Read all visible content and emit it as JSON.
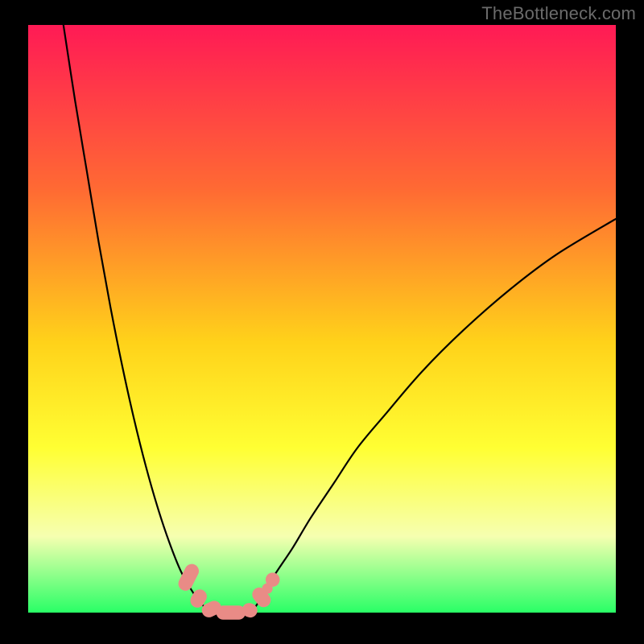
{
  "watermark": "TheBottleneck.com",
  "colors": {
    "bg": "#000000",
    "grad_top": "#ff1a55",
    "grad_mid1": "#ff6a33",
    "grad_mid2": "#ffd21a",
    "grad_mid3": "#ffff33",
    "grad_low": "#f6ffb0",
    "grad_bottom": "#29ff66",
    "curve": "#000000",
    "marker_fill": "#e98b86",
    "marker_stroke": "#d66e69"
  },
  "chart_data": {
    "type": "line",
    "title": "",
    "xlabel": "",
    "ylabel": "",
    "xlim": [
      0,
      100
    ],
    "ylim": [
      0,
      100
    ],
    "series": [
      {
        "name": "left-curve",
        "x": [
          6,
          8,
          10,
          12,
          14,
          16,
          18,
          20,
          22,
          24,
          26,
          28,
          29.5,
          31
        ],
        "y": [
          100,
          87,
          75,
          63,
          52,
          42,
          33,
          25,
          18,
          12,
          7,
          3.5,
          1.5,
          0
        ]
      },
      {
        "name": "right-curve",
        "x": [
          38,
          40,
          42,
          45,
          48,
          52,
          56,
          61,
          67,
          74,
          82,
          90,
          100
        ],
        "y": [
          0,
          3,
          6.5,
          11,
          16,
          22,
          28,
          34,
          41,
          48,
          55,
          61,
          67
        ]
      }
    ],
    "floor_segment": {
      "x": [
        31,
        38
      ],
      "y": [
        0,
        0
      ]
    },
    "markers": [
      {
        "shape": "capsule",
        "cx": 27.3,
        "cy": 6.0,
        "len": 4.8,
        "angle": 63,
        "w": 2.4
      },
      {
        "shape": "capsule",
        "cx": 29.0,
        "cy": 2.4,
        "len": 3.2,
        "angle": 60,
        "w": 2.4
      },
      {
        "shape": "capsule",
        "cx": 31.2,
        "cy": 0.6,
        "len": 3.4,
        "angle": 25,
        "w": 2.4
      },
      {
        "shape": "capsule",
        "cx": 34.5,
        "cy": 0.0,
        "len": 5.0,
        "angle": 0,
        "w": 2.4
      },
      {
        "shape": "capsule",
        "cx": 37.7,
        "cy": 0.4,
        "len": 2.6,
        "angle": -20,
        "w": 2.4
      },
      {
        "shape": "capsule",
        "cx": 39.7,
        "cy": 2.6,
        "len": 3.6,
        "angle": -52,
        "w": 2.4
      },
      {
        "shape": "dot",
        "cx": 41.6,
        "cy": 5.6,
        "r": 1.2
      },
      {
        "shape": "dot",
        "cx": 40.7,
        "cy": 4.1,
        "r": 0.9
      }
    ]
  }
}
